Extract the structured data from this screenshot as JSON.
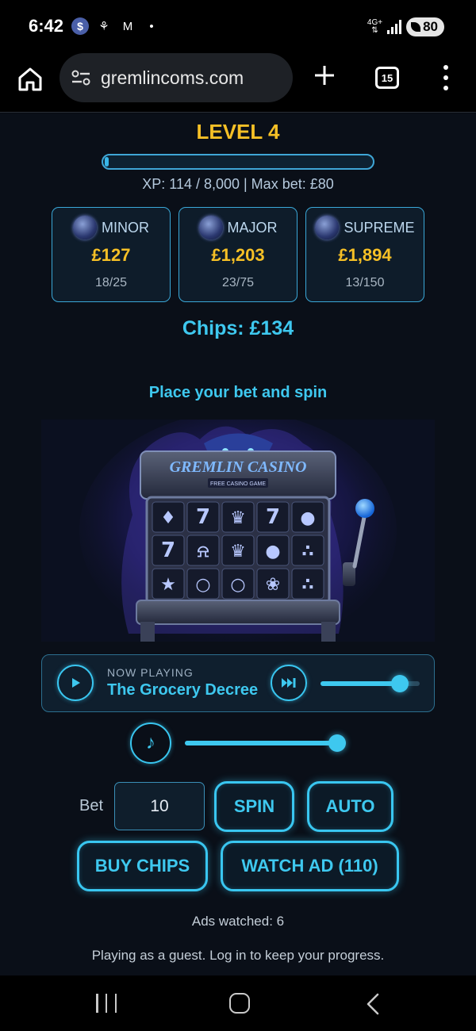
{
  "status_bar": {
    "time": "6:42",
    "network": "4G+",
    "battery": "80"
  },
  "browser": {
    "url": "gremlincoms.com",
    "tab_count": "15"
  },
  "game": {
    "level_title": "LEVEL 4",
    "xp_progress": 0.0143,
    "xp_text": "XP: 114 / 8,000  |  Max bet: £80",
    "jackpots": [
      {
        "name": "MINOR",
        "amount": "£127",
        "count": "18/25",
        "icon": "minor-coin-icon"
      },
      {
        "name": "MAJOR",
        "amount": "£1,203",
        "count": "23/75",
        "icon": "major-ring-icon"
      },
      {
        "name": "SUPREME",
        "amount": "£1,894",
        "count": "13/150",
        "icon": "supreme-crown-icon"
      }
    ],
    "chips": "Chips: £134",
    "prompt": "Place your bet and spin",
    "slot_logo": "GREMLIN CASINO",
    "slot_sublogo": "FREE CASINO GAME",
    "slot_symbols": [
      [
        "gremlin",
        "seven",
        "crown",
        "seven",
        "coin"
      ],
      [
        "seven",
        "bell",
        "crown",
        "coin",
        "grapes"
      ],
      [
        "star",
        "ring",
        "ring",
        "cherries",
        "grapes"
      ]
    ]
  },
  "player": {
    "now_playing_label": "NOW PLAYING",
    "track_title": "The Grocery Decree",
    "track_progress": 0.8,
    "music_volume": 1.0
  },
  "controls": {
    "bet_label": "Bet",
    "bet_value": "10",
    "spin_label": "SPIN",
    "auto_label": "AUTO",
    "buy_chips_label": "BUY CHIPS",
    "watch_ad_label": "WATCH AD (110)"
  },
  "footer": {
    "ads_watched": "Ads watched: 6",
    "guest_notice": "Playing as a guest. Log in to keep your progress."
  },
  "colors": {
    "accent": "#3ec8ef",
    "gold": "#f6c026",
    "background": "#0a0f18"
  }
}
